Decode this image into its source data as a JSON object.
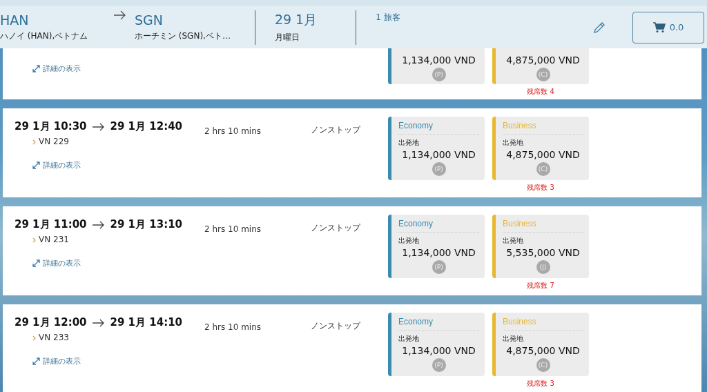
{
  "header": {
    "origin_code": "HAN",
    "origin_name": "ハノイ (HAN),ベトナム",
    "destination_code": "SGN",
    "destination_name": "ホーチミン (SGN),ベト…",
    "date": "29 1月",
    "weekday": "月曜日",
    "passengers": "1 旅客",
    "cart_total": "0.0"
  },
  "flights": [
    {
      "details_link": "詳細の表示",
      "fares": [
        {
          "kind": "economy",
          "color": "#3a8bb0",
          "price": "1,134,000 VND",
          "fare_class": "(P)"
        },
        {
          "kind": "business",
          "color": "#e8b830",
          "price": "4,875,000 VND",
          "fare_class": "(C)",
          "seats_left": "残席数 4"
        }
      ]
    },
    {
      "depart": "29 1月 10:30",
      "arrive": "29 1月 12:40",
      "flight_no": "VN 229",
      "duration": "2 hrs 10 mins",
      "stops": "ノンストップ",
      "details_link": "詳細の表示",
      "fares": [
        {
          "kind": "economy",
          "cabin": "Economy",
          "color": "#3a8bb0",
          "origin_label": "出発地",
          "price": "1,134,000 VND",
          "fare_class": "(P)"
        },
        {
          "kind": "business",
          "cabin": "Business",
          "color": "#e8b830",
          "origin_label": "出発地",
          "price": "4,875,000 VND",
          "fare_class": "(C)",
          "seats_left": "残席数 3"
        }
      ]
    },
    {
      "depart": "29 1月 11:00",
      "arrive": "29 1月 13:10",
      "flight_no": "VN 231",
      "duration": "2 hrs 10 mins",
      "stops": "ノンストップ",
      "details_link": "詳細の表示",
      "fares": [
        {
          "kind": "economy",
          "cabin": "Economy",
          "color": "#3a8bb0",
          "origin_label": "出発地",
          "price": "1,134,000 VND",
          "fare_class": "(P)"
        },
        {
          "kind": "business",
          "cabin": "Business",
          "color": "#e8b830",
          "origin_label": "出発地",
          "price": "5,535,000 VND",
          "fare_class": "(J)",
          "seats_left": "残席数 7"
        }
      ]
    },
    {
      "depart": "29 1月 12:00",
      "arrive": "29 1月 14:10",
      "flight_no": "VN 233",
      "duration": "2 hrs 10 mins",
      "stops": "ノンストップ",
      "details_link": "詳細の表示",
      "fares": [
        {
          "kind": "economy",
          "cabin": "Economy",
          "color": "#3a8bb0",
          "origin_label": "出発地",
          "price": "1,134,000 VND",
          "fare_class": "(P)"
        },
        {
          "kind": "business",
          "cabin": "Business",
          "color": "#e8b830",
          "origin_label": "出発地",
          "price": "4,875,000 VND",
          "fare_class": "(C)",
          "seats_left": "残席数 3"
        }
      ]
    }
  ]
}
